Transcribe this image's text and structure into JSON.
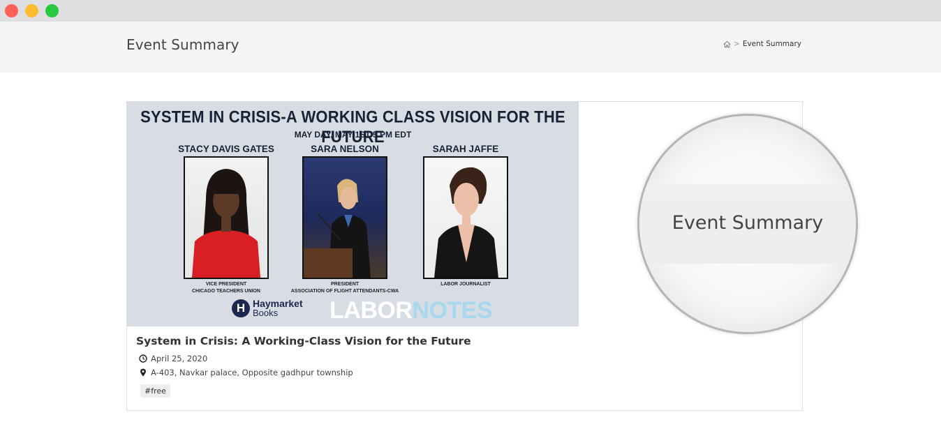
{
  "window": {
    "controls": [
      "close",
      "minimize",
      "maximize"
    ]
  },
  "header": {
    "title": "Event Summary",
    "breadcrumb": {
      "home_icon": "home-icon",
      "separator": ">",
      "current": "Event Summary"
    }
  },
  "event": {
    "poster": {
      "headline": "SYSTEM IN CRISIS-A WORKING CLASS VISION FOR THE FUTURE",
      "date_line": "MAY DAY, MAY 1ST 5 PM EDT",
      "speakers": [
        {
          "name": "STACY DAVIS GATES",
          "role_line1": "VICE PRESIDENT",
          "role_line2": "CHICAGO TEACHERS UNION"
        },
        {
          "name": "SARA NELSON",
          "role_line1": "PRESIDENT",
          "role_line2": "ASSOCIATION OF FLIGHT ATTENDANTS-CWA"
        },
        {
          "name": "SARAH JAFFE",
          "role_line1": "LABOR JOURNALIST",
          "role_line2": ""
        }
      ],
      "publisher_logo_letter": "H",
      "publisher_name_line1": "Haymarket",
      "publisher_name_line2": "Books",
      "sponsor_part1": "LABOR",
      "sponsor_part2": "NOTES"
    },
    "title": "System in Crisis: A Working-Class Vision for the Future",
    "date": "April 25, 2020",
    "location": "A-403, Navkar palace, Opposite gadhpur township",
    "tag": "#free"
  },
  "magnifier": {
    "text": "Event Summary"
  }
}
